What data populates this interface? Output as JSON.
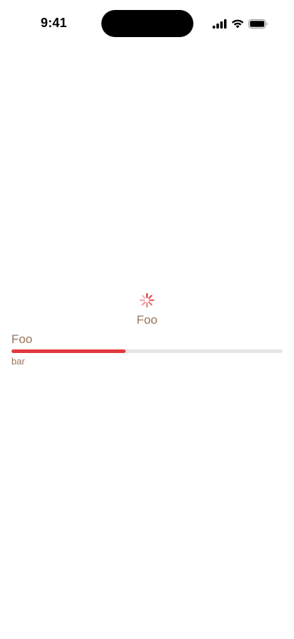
{
  "status_bar": {
    "time": "9:41",
    "icons": [
      "cellular-signal-icon",
      "wifi-icon",
      "battery-icon"
    ]
  },
  "loader": {
    "icon": "activity-spinner-icon",
    "label": "Foo",
    "color": "#e2383f"
  },
  "progress": {
    "title": "Foo",
    "caption": "bar",
    "value": 0.42,
    "fill_color": "#e2383f",
    "track_color": "#e5e5e5"
  },
  "colors": {
    "text_accent": "#9a7358",
    "background": "#ffffff"
  }
}
